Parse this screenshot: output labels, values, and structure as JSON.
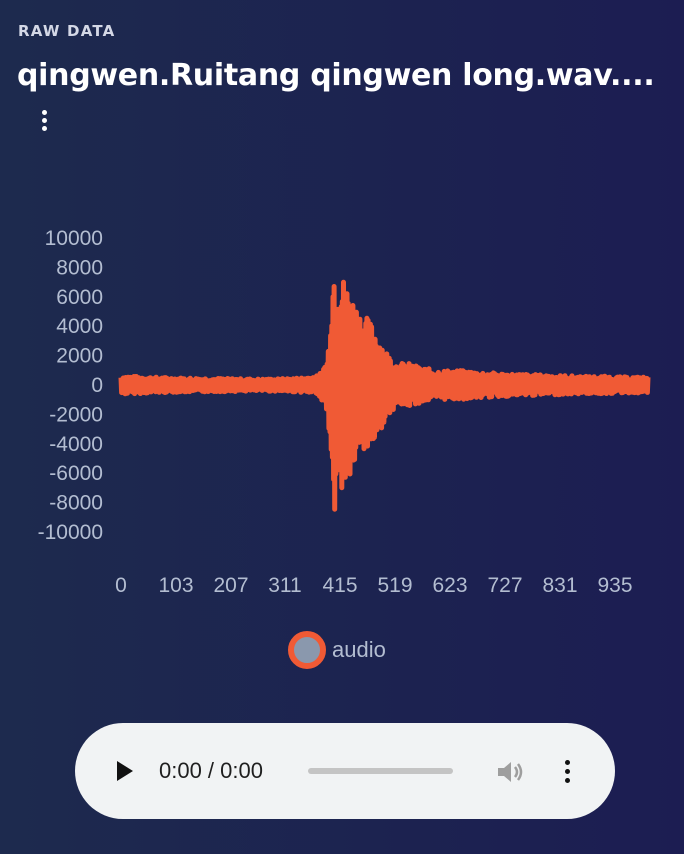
{
  "header": {
    "section_label": "RAW DATA",
    "title": "qingwen.Ruitang qingwen long.wav...."
  },
  "menu_icon": "vertical-ellipsis-icon",
  "chart_data": {
    "type": "line",
    "xlabel": "",
    "ylabel": "",
    "x_ticks": [
      "0",
      "103",
      "207",
      "311",
      "415",
      "519",
      "623",
      "727",
      "831",
      "935"
    ],
    "y_ticks": [
      "10000",
      "8000",
      "6000",
      "4000",
      "2000",
      "0",
      "-2000",
      "-4000",
      "-6000",
      "-8000",
      "-10000"
    ],
    "xlim": [
      0,
      1000
    ],
    "ylim": [
      -10000,
      10000
    ],
    "grid": false,
    "legend_position": "bottom",
    "series": [
      {
        "name": "audio",
        "color": "#f05a35",
        "envelope": {
          "x": [
            0,
            20,
            60,
            100,
            150,
            200,
            260,
            300,
            340,
            375,
            392,
            400,
            405,
            412,
            420,
            430,
            440,
            455,
            470,
            485,
            500,
            520,
            545,
            570,
            600,
            640,
            680,
            720,
            760,
            800,
            840,
            880,
            920,
            950,
            1000
          ],
          "amplitude": [
            650,
            600,
            550,
            500,
            480,
            450,
            420,
            430,
            500,
            650,
            1800,
            7000,
            8700,
            8300,
            7500,
            6800,
            6000,
            5000,
            4500,
            3700,
            2500,
            1500,
            1500,
            1200,
            1000,
            1000,
            900,
            800,
            750,
            700,
            650,
            600,
            600,
            550,
            550
          ]
        }
      }
    ]
  },
  "legend": {
    "label": "audio",
    "marker_color": "#f05a35",
    "marker_fill": "#8a98ad"
  },
  "player": {
    "time": "0:00 / 0:00",
    "play_icon": "play-icon",
    "volume_icon": "volume-icon",
    "menu_icon": "vertical-ellipsis-icon"
  }
}
